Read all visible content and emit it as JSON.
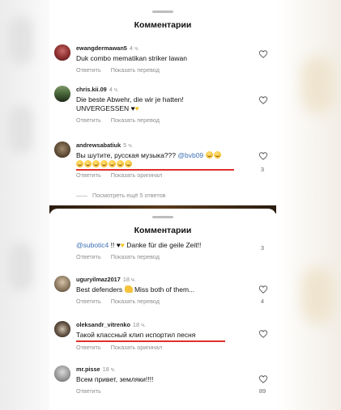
{
  "colors": {
    "mention": "#3d6fb4",
    "muted": "#8e8e8e",
    "underline": "#e0302a"
  },
  "top_sheet": {
    "title": "Комментарии",
    "comments": [
      {
        "user": "ewangdermawan5",
        "time": "4 ч.",
        "text": "Duk combo mematikan striker lawan",
        "reply": "Ответить",
        "translate": "Показать перевод",
        "likes": ""
      },
      {
        "user": "chris.kii.09",
        "time": "4 ч.",
        "text_line1": "Die beste Abwehr, die wir je hatten!",
        "text_line2": "UNVERGESSEN",
        "reply": "Ответить",
        "translate": "Показать перевод",
        "likes": ""
      },
      {
        "user": "andrewsabatiuk",
        "time": "5 ч.",
        "text": "Вы шутите, русская музыка???",
        "mention": "@bvb09",
        "reply": "Ответить",
        "translate": "Показать оригинал",
        "likes": "3"
      }
    ],
    "view_more": "Посмотреть ещё 5 ответов"
  },
  "bottom_sheet": {
    "title": "Комментарии",
    "comments": [
      {
        "mention": "@subotic4",
        "text": "Danke für die geile Zeit!!",
        "reply": "Ответить",
        "translate": "Показать перевод",
        "likes": "3"
      },
      {
        "user": "uguryilmaz2017",
        "time": "18 ч.",
        "text_a": "Best defenders",
        "text_b": "Miss both of them...",
        "reply": "Ответить",
        "translate": "Показать перевод",
        "likes": "4"
      },
      {
        "user": "oleksandr_vitrenko",
        "time": "18 ч.",
        "text": "Такой классный клип испортил песня",
        "reply": "Ответить",
        "translate": "Показать оригинал",
        "likes": ""
      },
      {
        "user": "mr.pisse",
        "time": "18 ч.",
        "text": "Всем привет, земляки!!!!",
        "reply": "Ответить",
        "likes": "89"
      }
    ]
  }
}
